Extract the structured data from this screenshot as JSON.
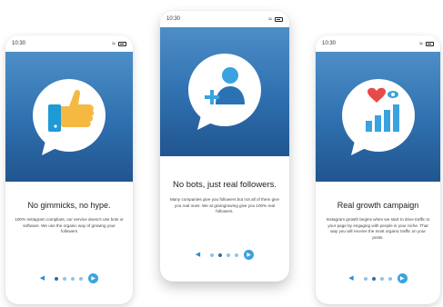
{
  "colors": {
    "hero_top": "#4d8ec8",
    "hero_bottom": "#21558f",
    "accent": "#3aa2e0",
    "thumb": "#f5b942",
    "cuff": "#1e9ad6",
    "heart": "#e74a4a"
  },
  "screens": [
    {
      "time": "10:30",
      "icon": "thumbs-up-icon",
      "title": "No gimmicks, no hype.",
      "description": "100% Instagram compliant, our service doesn't use bots or software. We use the organic way of growing your followers"
    },
    {
      "time": "10:30",
      "icon": "add-user-icon",
      "title": "No bots, just real followers.",
      "description": "Many companies give you followers but not all of them give you real ones. We at gramgrowing give you 100% real followers."
    },
    {
      "time": "10:30",
      "icon": "growth-chart-icon",
      "title": "Real growth campaign",
      "description": "Instagram growth begins when we start to drive traffic to your page by engaging with people in your niche. That way you will receive the most organic traffic on your posts."
    }
  ],
  "pager": {
    "prev_icon": "chevron-left-icon",
    "next_icon": "chevron-right-icon",
    "dot_count": 4
  }
}
